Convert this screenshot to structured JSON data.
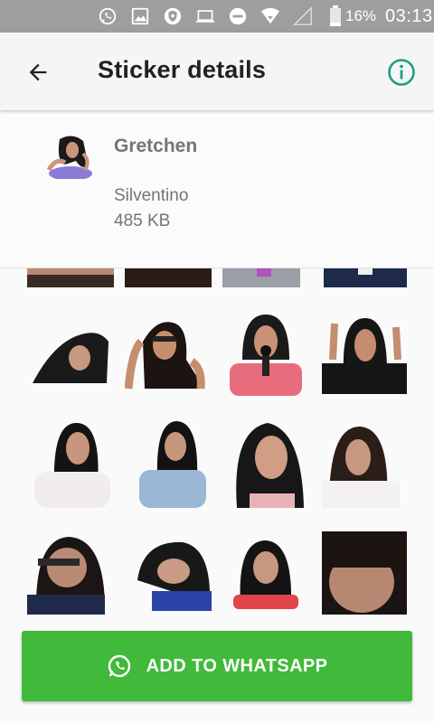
{
  "status_bar": {
    "battery": "16%",
    "time": "03:13",
    "icons": [
      "whatsapp-icon",
      "image-icon",
      "shield-icon",
      "laptop-icon",
      "do-not-disturb-icon",
      "wifi-icon",
      "signal-icon",
      "battery-icon"
    ]
  },
  "app_bar": {
    "title": "Sticker details",
    "back_icon": "arrow-back-icon",
    "info_icon": "info-icon"
  },
  "pack": {
    "name": "Gretchen",
    "author": "Silventino",
    "size": "485 KB"
  },
  "stickers": {
    "count_visible": 16,
    "rows": 4,
    "columns": 4
  },
  "action": {
    "add_label": "ADD TO WHATSAPP",
    "icon": "whatsapp-icon"
  },
  "colors": {
    "accent_green": "#41b93a",
    "info_teal": "#1e9e84",
    "status_bar": "#9e9e9e"
  }
}
